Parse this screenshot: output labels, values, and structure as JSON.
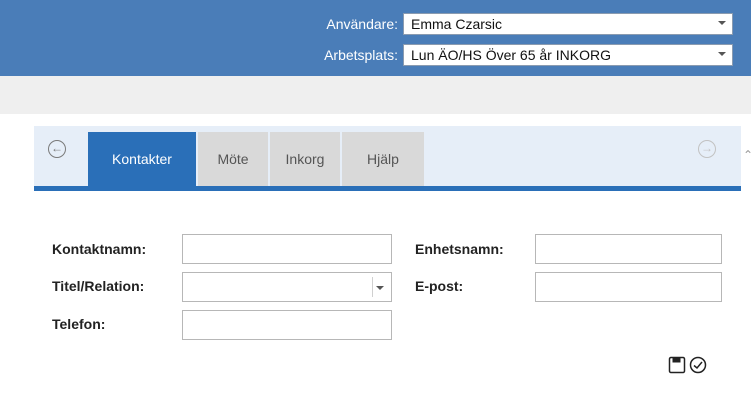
{
  "header": {
    "user_label": "Användare:",
    "user_value": "Emma Czarsic",
    "workplace_label": "Arbetsplats:",
    "workplace_value": "Lun ÄO/HS Över 65 år INKORG",
    "background_color": "#4a7db8"
  },
  "tabs": [
    {
      "label": "Kontakter",
      "active": true
    },
    {
      "label": "Möte",
      "active": false
    },
    {
      "label": "Inkorg",
      "active": false
    },
    {
      "label": "Hjälp",
      "active": false
    }
  ],
  "nav": {
    "back_icon": "arrow-left-circle-icon",
    "forward_icon": "arrow-right-circle-icon"
  },
  "form": {
    "contact_name_label": "Kontaktnamn:",
    "contact_name_value": "",
    "title_label": "Titel/Relation:",
    "title_value": "",
    "phone_label": "Telefon:",
    "phone_value": "",
    "unit_name_label": "Enhetsnamn:",
    "unit_name_value": "",
    "email_label": "E-post:",
    "email_value": ""
  },
  "actions": {
    "save_icon": "save-icon",
    "confirm_icon": "check-circle-icon"
  },
  "accent_color": "#2a6fb8"
}
